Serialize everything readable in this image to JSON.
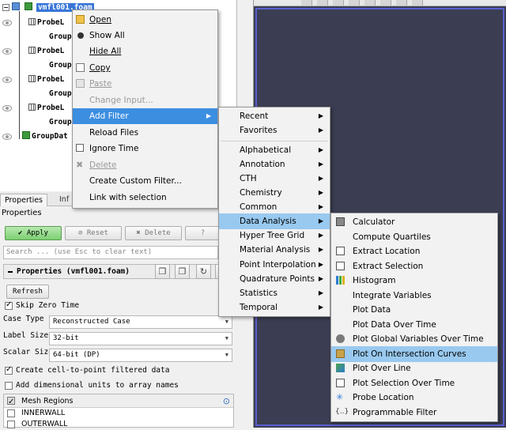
{
  "pipeline": {
    "root_label": "vmfl001.foam",
    "probe_label": "ProbeL",
    "group_label": "Group",
    "group_data_label": "GroupDat"
  },
  "properties_panel": {
    "tabs": [
      "Properties",
      "Inf"
    ],
    "title": "Properties",
    "apply_label": "Apply",
    "reset_label": "Reset",
    "delete_label": "Delete",
    "help_label": "?",
    "search_placeholder": "Search ... (use Esc to clear text)",
    "section_title": "Properties (vmfl001.foam)",
    "refresh_label": "Refresh",
    "skip_zero_time": "Skip Zero Time",
    "case_type_label": "Case Type",
    "case_type_value": "Reconstructed Case",
    "label_size_label": "Label Size",
    "label_size_value": "32-bit",
    "scalar_size_label": "Scalar Size",
    "scalar_size_value": "64-bit (DP)",
    "create_cell_to_point": "Create cell-to-point filtered data",
    "add_dimensional_units": "Add dimensional units to array names",
    "mesh_regions_header": "Mesh Regions",
    "mesh_regions": [
      "INNERWALL",
      "OUTERWALL"
    ]
  },
  "context_menu": {
    "items": [
      {
        "label": "Open",
        "icon": "folder-open-icon",
        "disabled": false
      },
      {
        "label": "Show All",
        "icon": "eye-icon",
        "disabled": false
      },
      {
        "label": "Hide All",
        "icon": "",
        "disabled": false
      },
      {
        "label": "Copy",
        "icon": "copy-icon",
        "disabled": false
      },
      {
        "label": "Paste",
        "icon": "paste-icon",
        "disabled": true
      },
      {
        "label": "Change Input...",
        "icon": "",
        "disabled": true
      },
      {
        "label": "Add Filter",
        "icon": "",
        "disabled": false
      },
      {
        "label": "Reload Files",
        "icon": "",
        "disabled": false
      },
      {
        "label": "Ignore Time",
        "icon": "checkbox-icon",
        "disabled": false
      },
      {
        "label": "Delete",
        "icon": "delete-icon",
        "disabled": true
      },
      {
        "label": "Create Custom Filter...",
        "icon": "",
        "disabled": false
      },
      {
        "label": "Link with selection",
        "icon": "",
        "disabled": false
      }
    ]
  },
  "filter_submenu": {
    "items": [
      "Recent",
      "Favorites",
      "Alphabetical",
      "Annotation",
      "CTH",
      "Chemistry",
      "Common",
      "Data Analysis",
      "Hyper Tree Grid",
      "Material Analysis",
      "Point Interpolation",
      "Quadrature Points",
      "Statistics",
      "Temporal"
    ]
  },
  "data_analysis_submenu": {
    "items": [
      "Calculator",
      "Compute Quartiles",
      "Extract Location",
      "Extract Selection",
      "Histogram",
      "Integrate Variables",
      "Plot Data",
      "Plot Data Over Time",
      "Plot Global Variables Over Time",
      "Plot On Intersection Curves",
      "Plot Over Line",
      "Plot Selection Over Time",
      "Probe Location",
      "Programmable Filter"
    ]
  },
  "colors": {
    "accent": "#3c8ee0",
    "highlight": "#99c9ef",
    "view_background": "#3b3d52",
    "apply_green": "#7dcf72"
  }
}
